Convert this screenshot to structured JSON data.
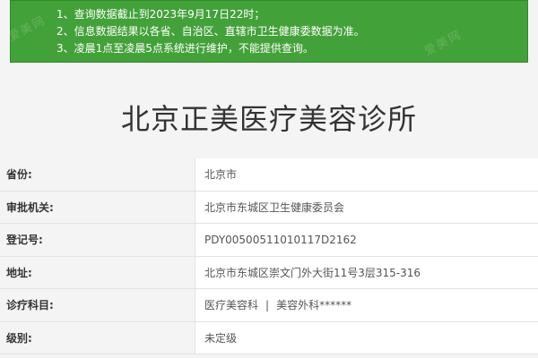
{
  "notice": {
    "lines": [
      "1、查询数据截止到2023年9月17日22时；",
      "2、信息数据结果以各省、自治区、直辖市卫生健康委数据为准。",
      "3、凌晨1点至凌晨5点系统进行维护，不能提供查询。"
    ],
    "watermark": "爱美网"
  },
  "title": "北京正美医疗美容诊所",
  "rows": [
    {
      "label": "省份:",
      "value": "北京市"
    },
    {
      "label": "审批机关:",
      "value": "北京市东城区卫生健康委员会"
    },
    {
      "label": "登记号:",
      "value": "PDY00500511010117D2162"
    },
    {
      "label": "地址:",
      "value": "北京市东城区崇文门外大街11号3层315-316"
    },
    {
      "label": "诊疗科目:",
      "value_parts": [
        "医疗美容科",
        "|",
        "美容外科******"
      ]
    },
    {
      "label": "级别:",
      "value": "未定级"
    }
  ],
  "colors": {
    "notice_bg": "#43a139",
    "page_bg": "#f4f4f4"
  }
}
